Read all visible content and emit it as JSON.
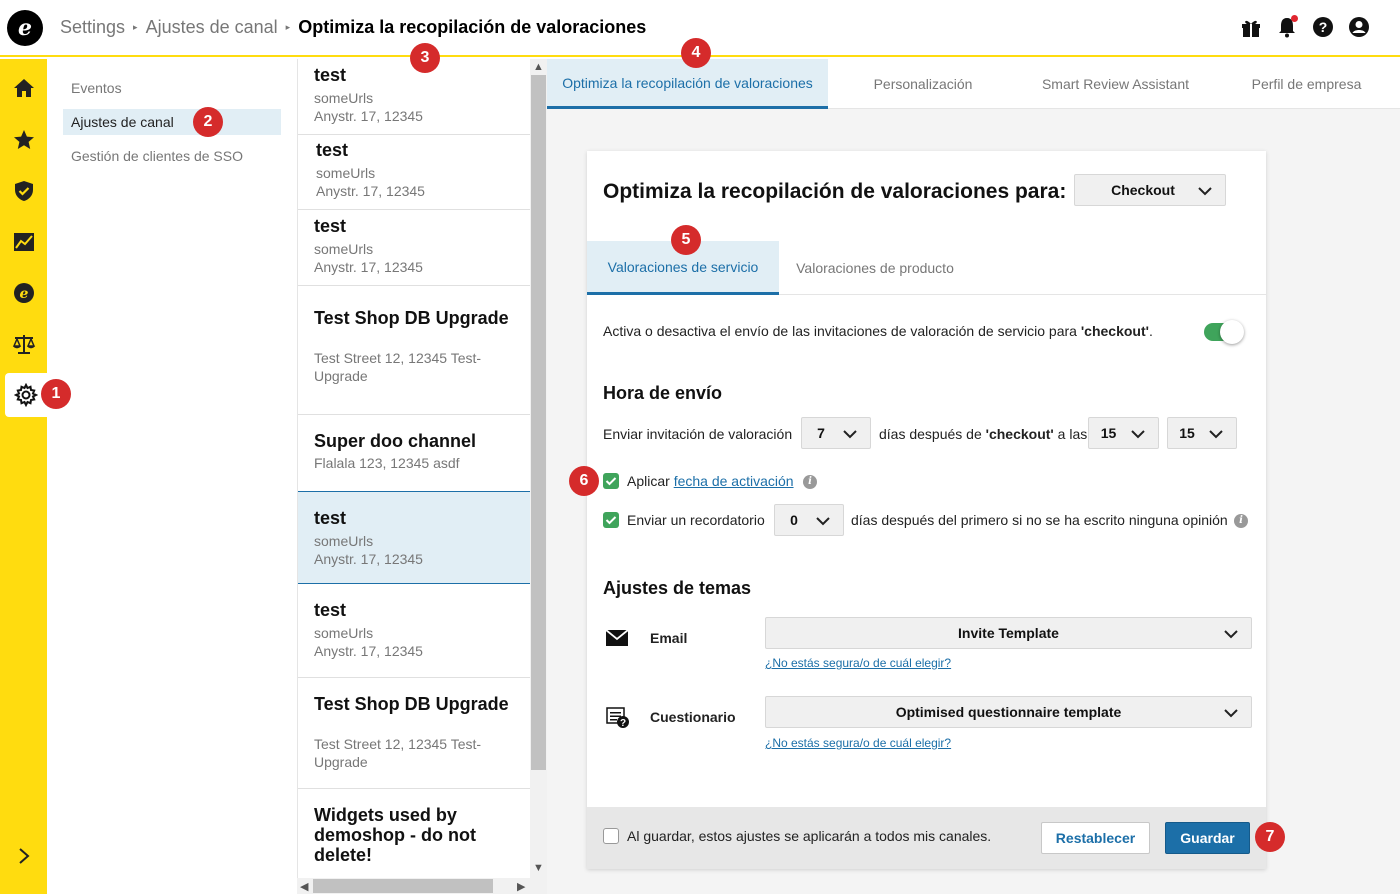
{
  "header": {
    "logo_letter": "e",
    "breadcrumb": [
      "Settings",
      "Ajustes de canal",
      "Optimiza la recopilación de valoraciones"
    ],
    "icons": [
      "gift-icon",
      "bell-icon",
      "help-icon",
      "account-icon"
    ]
  },
  "leftnav": {
    "icons": [
      "home-icon",
      "star-icon",
      "shield-check-icon",
      "analytics-icon",
      "trusted-e-icon",
      "scales-icon",
      "gear-icon",
      "chevron-right-icon"
    ],
    "active": "gear-icon"
  },
  "subnav": {
    "items": [
      "Eventos",
      "Ajustes de canal",
      "Gestión de clientes de SSO"
    ],
    "selected": "Ajustes de canal"
  },
  "channels": [
    {
      "name": "test",
      "line1": "someUrls",
      "line2": "Anystr. 17, 12345"
    },
    {
      "name": "test",
      "line1": "someUrls",
      "line2": "Anystr. 17, 12345"
    },
    {
      "name": "test",
      "line1": "someUrls",
      "line2": "Anystr. 17, 12345"
    },
    {
      "name": "Test Shop DB Upgrade",
      "line1": "Test Street 12, 12345 Test-",
      "line2": "Upgrade"
    },
    {
      "name": "Super doo channel",
      "line1": "Flalala 123, 12345 asdf",
      "line2": ""
    },
    {
      "name": "test",
      "line1": "someUrls",
      "line2": "Anystr. 17, 12345"
    },
    {
      "name": "test",
      "line1": "someUrls",
      "line2": "Anystr. 17, 12345"
    },
    {
      "name": "Test Shop DB Upgrade",
      "line1": "Test Street 12, 12345 Test-",
      "line2": "Upgrade"
    },
    {
      "name": "Widgets used by demoshop - do not delete!",
      "line1": "",
      "line2": ""
    }
  ],
  "tabs": [
    "Optimiza la recopilación de valoraciones",
    "Personalización",
    "Smart Review Assistant",
    "Perfil de empresa"
  ],
  "card": {
    "title": "Optimiza la recopilación de valoraciones para:",
    "event_select": "Checkout",
    "subtabs": [
      "Valoraciones de servicio",
      "Valoraciones de producto"
    ],
    "toggle_text_pre": "Activa o desactiva el envío de las invitaciones de valoración de servicio para ",
    "toggle_text_bold": "'checkout'",
    "toggle_text_post": ".",
    "toggle_on": true,
    "send_time_heading": "Hora de envío",
    "send_invite_label": "Enviar invitación de valoración",
    "days_value": "7",
    "days_after_pre": "días después de ",
    "days_after_bold": "'checkout'",
    "days_after_post": " a las",
    "hour_value": "15",
    "minute_value": "15",
    "apply_label": "Aplicar",
    "apply_link": "fecha de activación",
    "apply_checked": true,
    "reminder_label": "Enviar un recordatorio",
    "reminder_value": "0",
    "reminder_suffix": "días después del primero si no se ha escrito ninguna opinión",
    "reminder_checked": true,
    "themes_heading": "Ajustes de temas",
    "email_label": "Email",
    "email_template": "Invite Template",
    "email_help": "¿No estás segura/o de cuál elegir?",
    "questionnaire_label": "Cuestionario",
    "questionnaire_template": "Optimised questionnaire template",
    "questionnaire_help": "¿No estás segura/o de cuál elegir?",
    "apply_all_label": "Al guardar, estos ajustes se aplicarán a todos mis canales.",
    "apply_all_checked": false,
    "reset_button": "Restablecer",
    "save_button": "Guardar"
  },
  "annotations": [
    "1",
    "2",
    "3",
    "4",
    "5",
    "6",
    "7"
  ],
  "colors": {
    "accent_yellow": "#ffdc0f",
    "primary_blue": "#1c6fa8",
    "badge_red": "#d52b2b",
    "toggle_green": "#3fa45b"
  }
}
